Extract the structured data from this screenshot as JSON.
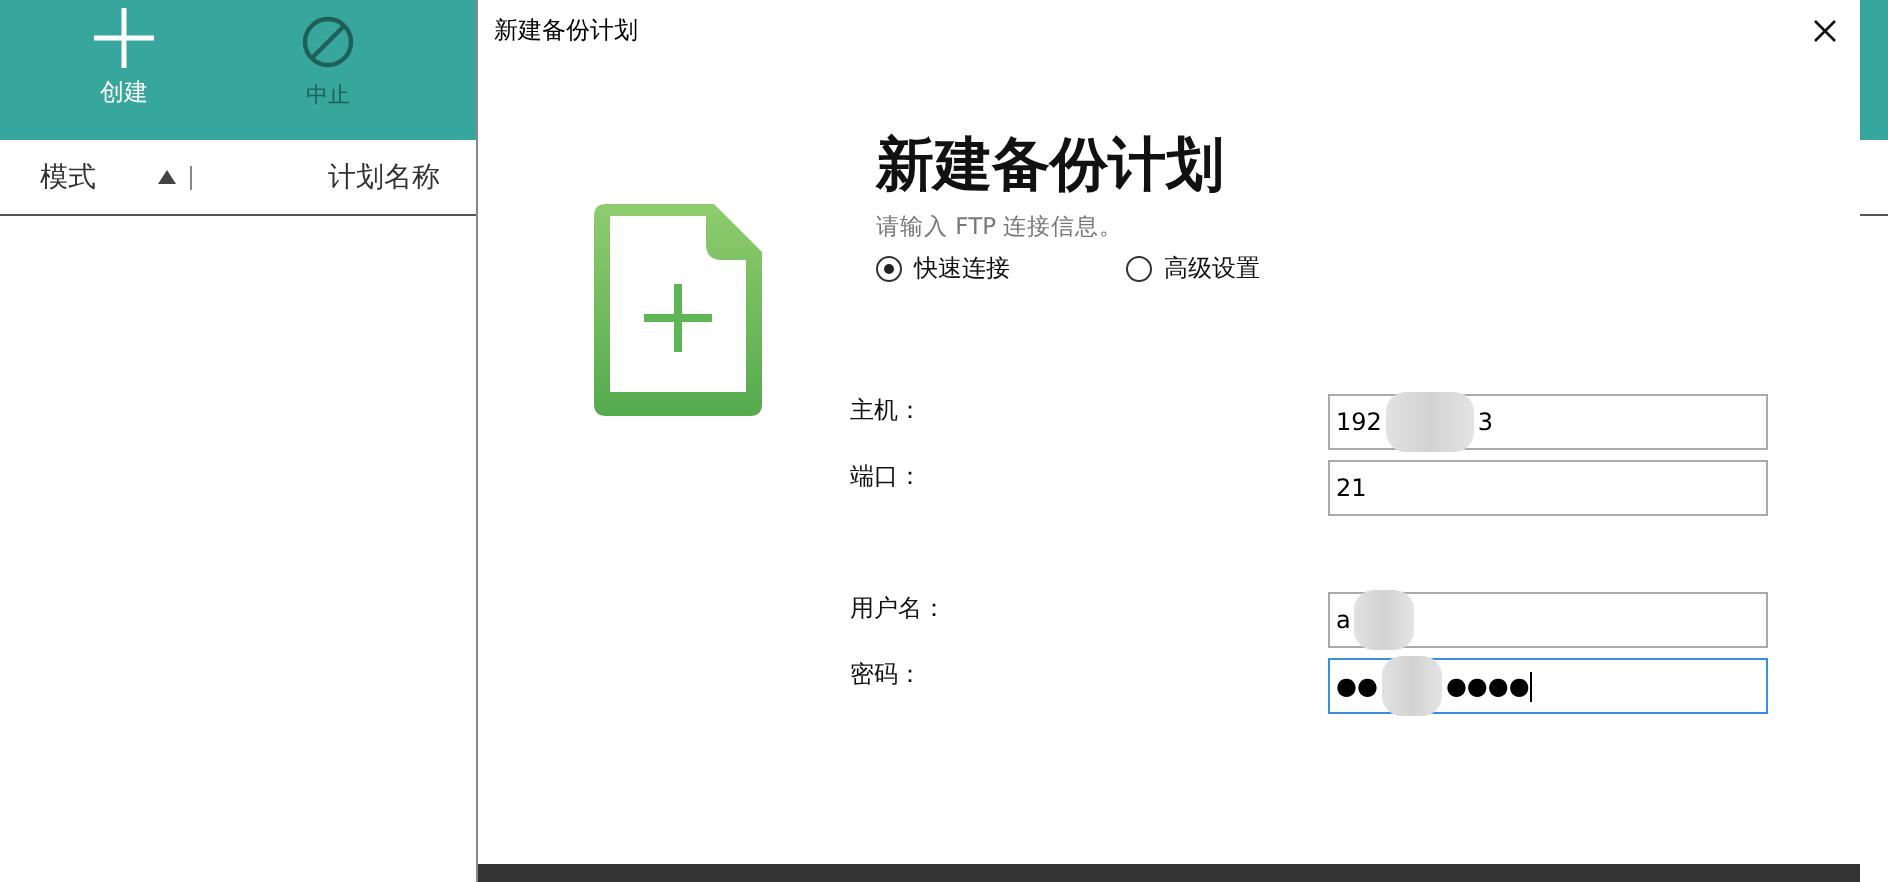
{
  "toolbar": {
    "buttons": [
      {
        "kind": "create",
        "label": "创建",
        "disabled": false
      },
      {
        "kind": "stop",
        "label": "中止",
        "disabled": true
      }
    ]
  },
  "table": {
    "columns": [
      {
        "label": "模式",
        "sorted": true
      },
      {
        "label": "计划名称",
        "sorted": false
      }
    ]
  },
  "dialog": {
    "title": "新建备份计划",
    "heading": "新建备份计划",
    "subtitle": "请输入 FTP 连接信息。",
    "modes": [
      {
        "label": "快速连接",
        "selected": true
      },
      {
        "label": "高级设置",
        "selected": false
      }
    ],
    "groups": [
      [
        {
          "label": "主机：",
          "value_start": "192",
          "value_end": "3",
          "redacted": true,
          "focused": false
        },
        {
          "label": "端口：",
          "value_start": "21",
          "focused": false
        }
      ],
      [
        {
          "label": "用户名：",
          "value_start": "a",
          "redacted": true,
          "focused": false
        },
        {
          "label": "密码：",
          "value_start": "●●",
          "value_end": "●●●●",
          "redacted": true,
          "focused": true
        }
      ]
    ]
  }
}
